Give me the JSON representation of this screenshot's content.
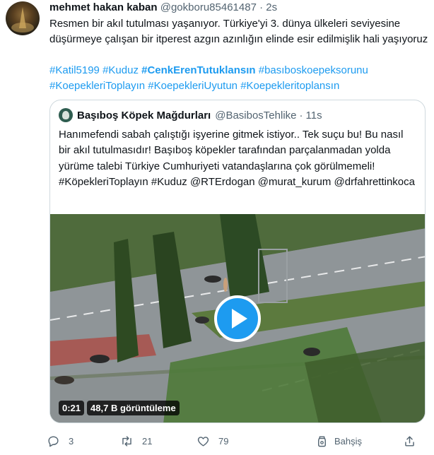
{
  "tweet": {
    "author_name": "mehmet hakan kaban",
    "author_handle": "@gokboru85461487",
    "separator": "·",
    "time": "2s",
    "text": "Resmen bir akıl tutulması yaşanıyor. Türkiye'yi 3. dünya ülkeleri seviyesine düşürmeye çalışan bir itperest azgın azınlığın elinde esir edilmişlik hali yaşıyoruz",
    "hashtags": [
      {
        "text": "#Katil5199",
        "bold": false
      },
      {
        "text": "#Kuduz",
        "bold": false
      },
      {
        "text": "#CenkErenTutuklansın",
        "bold": true
      },
      {
        "text": "#basıboskoepeksorunu",
        "bold": false
      },
      {
        "text": "#KoepekleriToplayın",
        "bold": false
      },
      {
        "text": "#KoepekleriUyutun",
        "bold": false
      },
      {
        "text": "#Koepekleritoplansın",
        "bold": false
      }
    ]
  },
  "quote": {
    "author_name": "Başıboş Köpek Mağdurları",
    "author_handle": "@BasibosTehlike",
    "separator": "·",
    "time": "11s",
    "text": "Hanımefendi sabah çalıştığı işyerine gitmek istiyor.. Tek suçu bu! Bu nasıl bir akıl tutulmasıdır! Başıboş köpekler tarafından parçalanmadan yolda yürüme talebi Türkiye Cumhuriyeti vatandaşlarına çok görülmemeli! #KöpekleriToplayın #Kuduz @RTErdogan @murat_kurum @drfahrettinkoca",
    "video": {
      "duration": "0:21",
      "views": "48,7 B görüntüleme"
    }
  },
  "actions": {
    "reply_count": "3",
    "retweet_count": "21",
    "like_count": "79",
    "tip_label": "Bahşiş"
  },
  "icons": {
    "reply": "reply-icon",
    "retweet": "retweet-icon",
    "like": "heart-icon",
    "tip": "tip-jar-icon",
    "share": "share-icon",
    "play": "play-icon"
  },
  "colors": {
    "accent": "#1d9bf0",
    "text": "#0f1419",
    "muted": "#536471",
    "border": "#cfd9de"
  }
}
